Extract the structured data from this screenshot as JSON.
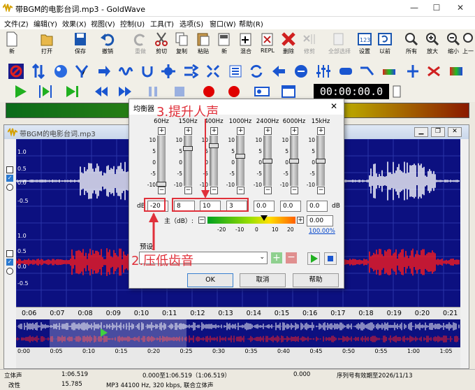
{
  "window": {
    "title": "带BGM的电影台词.mp3 - GoldWave"
  },
  "menu": [
    "文件(Z)",
    "编辑(Y)",
    "效果(X)",
    "视图(V)",
    "控制(U)",
    "工具(T)",
    "选项(S)",
    "窗口(W)",
    "帮助(R)"
  ],
  "toolbar1": [
    {
      "label": "新",
      "icon": "new-file-icon"
    },
    {
      "label": "打开",
      "icon": "open-folder-icon"
    },
    {
      "label": "保存",
      "icon": "save-icon"
    },
    {
      "label": "撤销",
      "icon": "undo-icon"
    },
    {
      "label": "重做",
      "icon": "redo-icon"
    },
    {
      "label": "剪切",
      "icon": "scissors-icon"
    },
    {
      "label": "复制",
      "icon": "copy-icon"
    },
    {
      "label": "粘贴",
      "icon": "paste-icon"
    },
    {
      "label": "新",
      "icon": "paste-new-icon"
    },
    {
      "label": "混合",
      "icon": "mix-icon"
    },
    {
      "label": "REPL",
      "icon": "replace-icon"
    },
    {
      "label": "删除",
      "icon": "delete-icon"
    },
    {
      "label": "修剪",
      "icon": "trim-icon"
    },
    {
      "label": "全部选择",
      "icon": "select-all-icon"
    },
    {
      "label": "设置",
      "icon": "set-marker-icon"
    },
    {
      "label": "以前",
      "icon": "previous-icon"
    },
    {
      "label": "所有",
      "icon": "zoom-all-icon"
    },
    {
      "label": "放大",
      "icon": "zoom-in-icon"
    },
    {
      "label": "缩小",
      "icon": "zoom-out-icon"
    },
    {
      "label": "上一",
      "icon": "zoom-prev-icon"
    }
  ],
  "timer": "00:00:00.0",
  "document": {
    "title": "带BGM的电影台词.mp3"
  },
  "timeline": [
    "0:06",
    "0:07",
    "0:08",
    "0:09",
    "0:10",
    "0:11",
    "0:12",
    "0:13",
    "0:14",
    "0:15",
    "0:16",
    "0:17",
    "0:18",
    "0:19",
    "0:20",
    "0:21"
  ],
  "overview_timeline": [
    "0:00",
    "0:05",
    "0:10",
    "0:15",
    "0:20",
    "0:25",
    "0:30",
    "0:35",
    "0:40",
    "0:45",
    "0:50",
    "0:55",
    "1:00",
    "1:05"
  ],
  "channel_labels": {
    "top": [
      "1.0",
      "0.5",
      "0.0",
      "-0.5"
    ],
    "bottom": [
      "1.0",
      "0.5",
      "0.0",
      "-0.5"
    ]
  },
  "equalizer": {
    "title": "均衡器",
    "bands": [
      {
        "freq": "60Hz",
        "value": "-20",
        "level": -20
      },
      {
        "freq": "150Hz",
        "value": "8",
        "level": 8
      },
      {
        "freq": "400Hz",
        "value": "10",
        "level": 10
      },
      {
        "freq": "1000Hz",
        "value": "3",
        "level": 3
      },
      {
        "freq": "2400Hz",
        "value": "0.0",
        "level": 0
      },
      {
        "freq": "6000Hz",
        "value": "0.0",
        "level": 0
      },
      {
        "freq": "15kHz",
        "value": "0.0",
        "level": 0
      }
    ],
    "scale": [
      "10",
      "5",
      "0",
      "-5",
      "-10"
    ],
    "db_label": "dB",
    "master_label": "主（dB）:",
    "master_scale": [
      "-20",
      "-10",
      "0",
      "10",
      "20"
    ],
    "master_value": "0.00",
    "master_percent": "100.00%",
    "preset_label": "预设",
    "ok": "OK",
    "cancel": "取消",
    "help": "帮助"
  },
  "annotations": {
    "step3": "3.提升人声",
    "step2": "2.压低齿音"
  },
  "status": {
    "row1": [
      "立体声",
      "1:06.519",
      "0.000至1:06.519（1:06.519）",
      "0.000",
      "序列号有效期至2026/11/13"
    ],
    "row2": [
      "改性",
      "15.785",
      "MP3 44100 Hz, 320 kbps, 联合立体声"
    ]
  },
  "colors": {
    "accent_red": "#e0303a",
    "wave_bg": "#0c1080",
    "wave_top": "#ffffff",
    "wave_bottom": "#ff1a1a"
  }
}
